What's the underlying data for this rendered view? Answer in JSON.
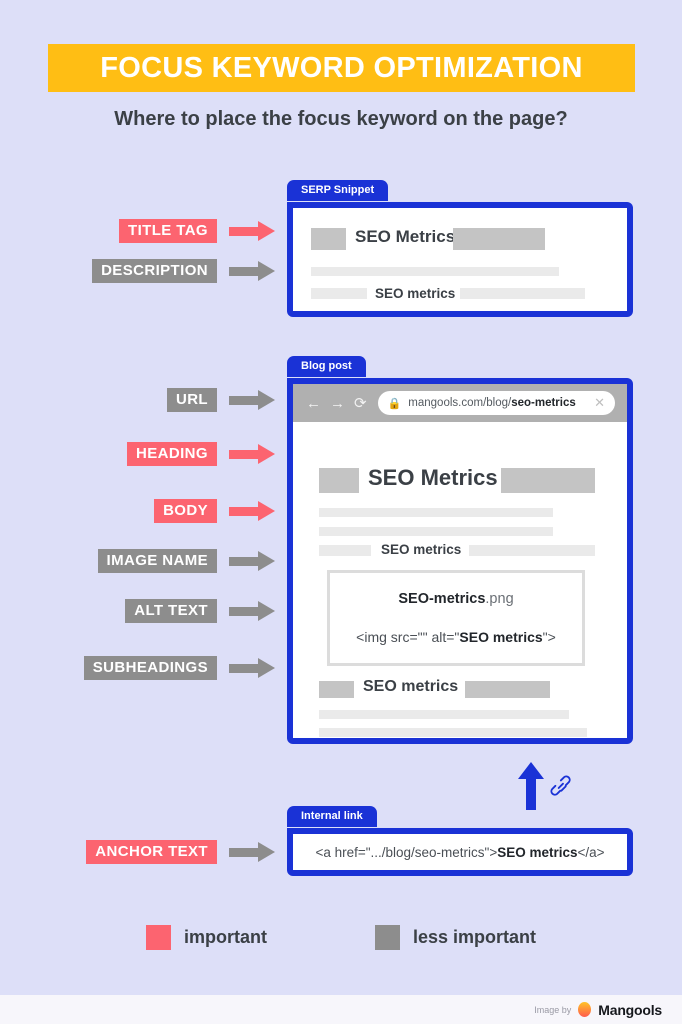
{
  "header": {
    "title": "FOCUS KEYWORD OPTIMIZATION",
    "subtitle": "Where to place the focus keyword on the page?"
  },
  "colors": {
    "background": "#DDDFF8",
    "accent_yellow": "#FFBE14",
    "important_red": "#FC6470",
    "less_important_gray": "#8D8D8D",
    "card_blue": "#1A32D6",
    "text_dark": "#3B4046"
  },
  "labels": [
    {
      "text": "TITLE TAG",
      "importance": "important"
    },
    {
      "text": "DESCRIPTION",
      "importance": "less important"
    },
    {
      "text": "URL",
      "importance": "less important"
    },
    {
      "text": "HEADING",
      "importance": "important"
    },
    {
      "text": "BODY",
      "importance": "important"
    },
    {
      "text": "IMAGE NAME",
      "importance": "less important"
    },
    {
      "text": "ALT TEXT",
      "importance": "less important"
    },
    {
      "text": "SUBHEADINGS",
      "importance": "less important"
    },
    {
      "text": "ANCHOR TEXT",
      "importance": "important"
    }
  ],
  "serp_card": {
    "tab": "SERP Snippet",
    "title_keyword": "SEO Metrics",
    "description_keyword": "SEO metrics"
  },
  "blog_card": {
    "tab": "Blog post",
    "browser": {
      "back_icon": "arrow-left-icon",
      "forward_icon": "arrow-right-icon",
      "reload_icon": "reload-icon",
      "lock_icon": "lock-icon",
      "url_prefix": "mangools.com/blog/",
      "url_keyword": "seo-metrics",
      "close_icon": "close-icon"
    },
    "heading_keyword": "SEO Metrics",
    "body_keyword": "SEO metrics",
    "image_name_prefix": "SEO-metrics",
    "image_name_suffix": ".png",
    "alt_code_prefix": "<img src=\"\" alt=\"",
    "alt_code_keyword": "SEO metrics",
    "alt_code_suffix": "\">",
    "subheading_keyword": "SEO metrics"
  },
  "internal_link_card": {
    "tab": "Internal link",
    "code_prefix": "<a href=\".../blog/seo-metrics\">",
    "code_keyword": "SEO metrics",
    "code_suffix": "</a>",
    "up_arrow_icon": "arrow-up-icon",
    "link_icon": "chain-link-icon"
  },
  "legend": [
    {
      "swatch": "important_red",
      "caption": "important"
    },
    {
      "swatch": "less_important_gray",
      "caption": "less important"
    }
  ],
  "footer": {
    "credit": "Image by",
    "logo_icon": "mango-logo-icon",
    "brand": "Mangools"
  }
}
